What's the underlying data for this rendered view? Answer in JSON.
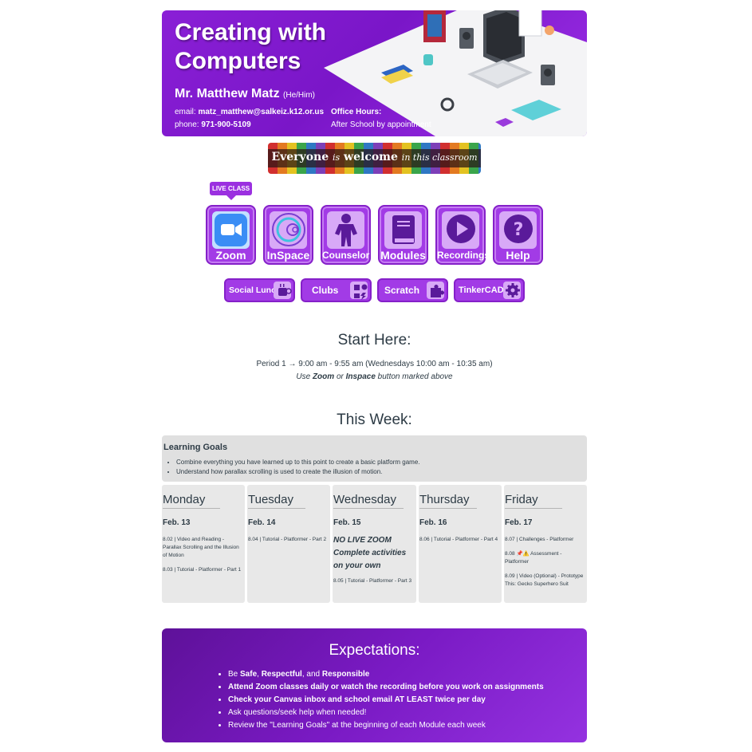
{
  "header": {
    "title": "Creating with Computers",
    "teacher_name": "Mr. Matthew Matz",
    "pronouns": "(He/Him)",
    "email_label": "email:",
    "email": "matz_matthew@salkeiz.k12.or.us",
    "phone_label": "phone:",
    "phone": "971-900-5109",
    "office_hours_label": "Office Hours:",
    "office_hours": "After School by appointment"
  },
  "welcome": {
    "word1": "Everyone",
    "word2": "is",
    "word3": "welcome",
    "word4": "in this classroom"
  },
  "live_tag": "LIVE CLASS",
  "nav_buttons": [
    {
      "label": "Zoom",
      "icon": "video-camera-icon"
    },
    {
      "label": "InSpace",
      "icon": "target-circles-icon"
    },
    {
      "label": "Counselor",
      "icon": "person-icon"
    },
    {
      "label": "Modules",
      "icon": "book-icon"
    },
    {
      "label": "Recordings",
      "icon": "play-icon"
    },
    {
      "label": "Help",
      "icon": "question-icon"
    }
  ],
  "pill_buttons": [
    {
      "label": "Social Lunch",
      "icon": "coffee-cup-icon"
    },
    {
      "label": "Clubs",
      "icon": "puzzle-heart-icon"
    },
    {
      "label": "Scratch",
      "icon": "puzzle-piece-icon"
    },
    {
      "label": "TinkerCAD",
      "icon": "gear-icon"
    }
  ],
  "start_here": {
    "heading": "Start Here:",
    "period_line": "Period 1 → 9:00 am - 9:55 am (Wednesdays 10:00 am - 10:35 am)",
    "use_prefix": "Use",
    "zoom_word": "Zoom",
    "or_word": "or",
    "inspace_word": "Inspace",
    "use_suffix": "button marked above"
  },
  "this_week": {
    "heading": "This Week:",
    "goals_title": "Learning Goals",
    "goals": [
      "Combine everything you have learned up to this point to create a basic platform game.",
      "Understand how parallax scrolling is used to create the illusion of motion."
    ],
    "days": [
      {
        "name": "Monday",
        "date": "Feb. 13",
        "items": [
          "8.02 | Video and Reading - Parallax Scrolling and the Illusion of Motion",
          "8.03 | Tutorial - Platformer - Part 1"
        ]
      },
      {
        "name": "Tuesday",
        "date": "Feb. 14",
        "items": [
          "8.04 | Tutorial - Platformer - Part 2"
        ]
      },
      {
        "name": "Wednesday",
        "date": "Feb. 15",
        "note": "NO LIVE ZOOM Complete activities on your own",
        "items": [
          "8.05 | Tutorial - Platformer - Part 3"
        ]
      },
      {
        "name": "Thursday",
        "date": "Feb. 16",
        "items": [
          "8.06 | Tutorial - Platformer - Part 4"
        ]
      },
      {
        "name": "Friday",
        "date": "Feb. 17",
        "items": [
          "8.07 | Challenges - Platformer",
          "8.08 📌⚠️ Assessment - Platformer",
          "8.09 | Video (Optional) - Prototype This: Gecko Superhero Suit"
        ]
      }
    ]
  },
  "expectations": {
    "heading": "Expectations:",
    "item1_a": "Be",
    "item1_b": "Safe",
    "item1_c": ",",
    "item1_d": "Respectful",
    "item1_e": ", and",
    "item1_f": "Responsible",
    "item2": "Attend Zoom classes daily or watch the recording before you work on assignments",
    "item3": "Check your Canvas inbox and school email AT LEAST twice per day",
    "item4": "Ask questions/seek help when needed!",
    "item5": "Review the \"Learning Goals\" at the beginning of each Module each week"
  },
  "colors": {
    "accent_purple": "#a23be6",
    "icon_bg": "#d8a9f7",
    "text_dark": "#2d3b45"
  }
}
